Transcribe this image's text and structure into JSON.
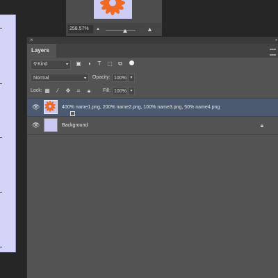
{
  "navigator": {
    "zoom_value": "258.57%",
    "zoom_slider_position": 0.6,
    "small_mountain_icon": "mountain-small-icon",
    "large_mountain_icon": "mountain-large-icon"
  },
  "panel": {
    "tab_label": "Layers",
    "filter": {
      "kind_label": "Kind",
      "icons": [
        "image-filter-icon",
        "adjustment-filter-icon",
        "type-filter-icon",
        "shape-filter-icon",
        "smart-object-filter-icon"
      ]
    },
    "blend_mode": "Normal",
    "opacity_label": "Opacity:",
    "opacity_value": "100%",
    "lock_label": "Lock:",
    "fill_label": "Fill:",
    "fill_value": "100%"
  },
  "layers": [
    {
      "name": "400% name1.png, 200% name2.png, 100% name3.png, 50% name4.png",
      "selected": true,
      "visible": true,
      "smart_object": true
    },
    {
      "name": "Background",
      "selected": false,
      "visible": true,
      "locked": true
    }
  ],
  "colors": {
    "selected_row": "#4b5a70",
    "panel_bg": "#535353",
    "canvas_bg": "#d4d4f8",
    "flower_orange": "#f06a26"
  }
}
